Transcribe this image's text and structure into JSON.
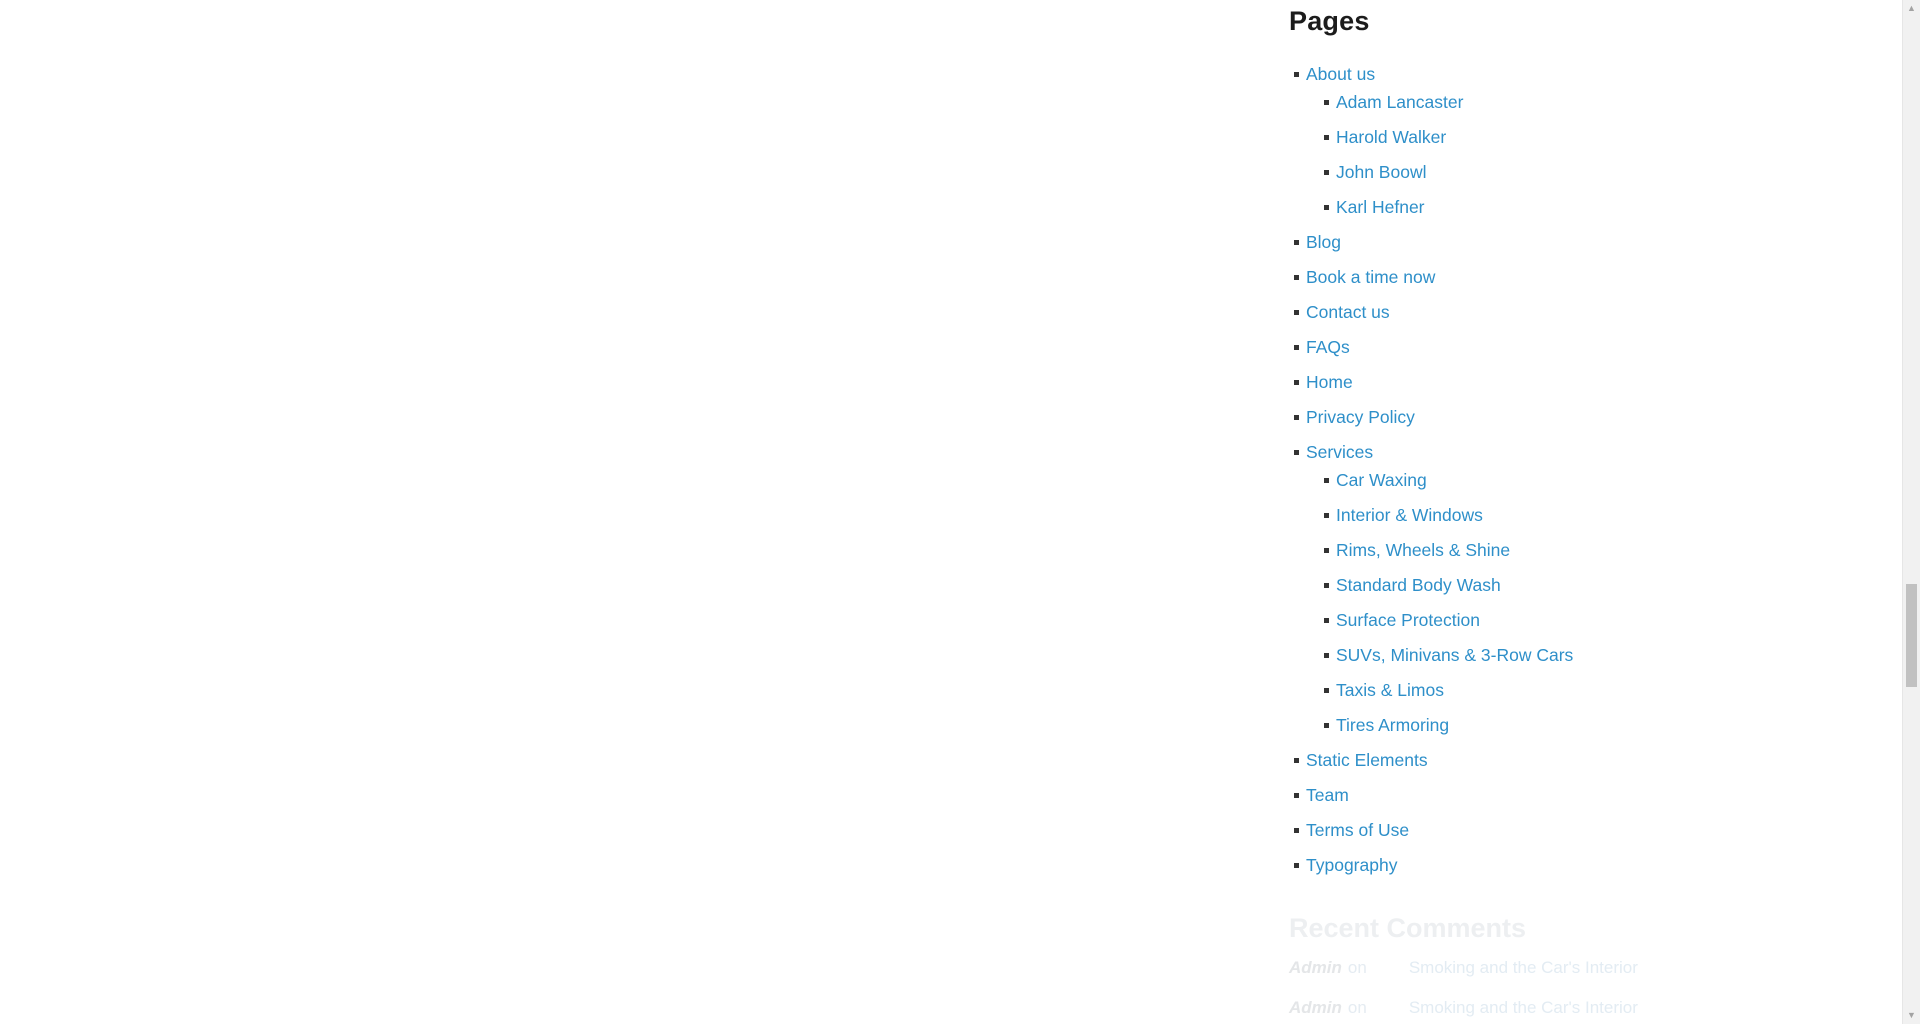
{
  "pages_widget": {
    "title": "Pages",
    "items": [
      {
        "label": "About us",
        "children": [
          {
            "label": "Adam Lancaster"
          },
          {
            "label": "Harold Walker"
          },
          {
            "label": "John Boowl"
          },
          {
            "label": "Karl Hefner"
          }
        ]
      },
      {
        "label": "Blog"
      },
      {
        "label": "Book a time now"
      },
      {
        "label": "Contact us"
      },
      {
        "label": "FAQs"
      },
      {
        "label": "Home"
      },
      {
        "label": "Privacy Policy"
      },
      {
        "label": "Services",
        "children": [
          {
            "label": "Car Waxing"
          },
          {
            "label": "Interior & Windows"
          },
          {
            "label": "Rims, Wheels & Shine"
          },
          {
            "label": "Standard Body Wash"
          },
          {
            "label": "Surface Protection"
          },
          {
            "label": "SUVs, Minivans & 3-Row Cars"
          },
          {
            "label": "Taxis & Limos"
          },
          {
            "label": "Tires Armoring"
          }
        ]
      },
      {
        "label": "Static Elements"
      },
      {
        "label": "Team"
      },
      {
        "label": "Terms of Use"
      },
      {
        "label": "Typography"
      }
    ]
  },
  "recent_comments": {
    "title": "Recent Comments",
    "comments": [
      {
        "author": "Admin",
        "on": "on",
        "post": "Smoking and the Car's Interior"
      },
      {
        "author": "Admin",
        "on": "on",
        "post": "Smoking and the Car's Interior"
      }
    ]
  },
  "colors": {
    "link": "#2e8fc9",
    "heading": "#1c1c1c",
    "bullet": "#333333"
  },
  "scrollbar": {
    "position_fraction": 0.57
  }
}
